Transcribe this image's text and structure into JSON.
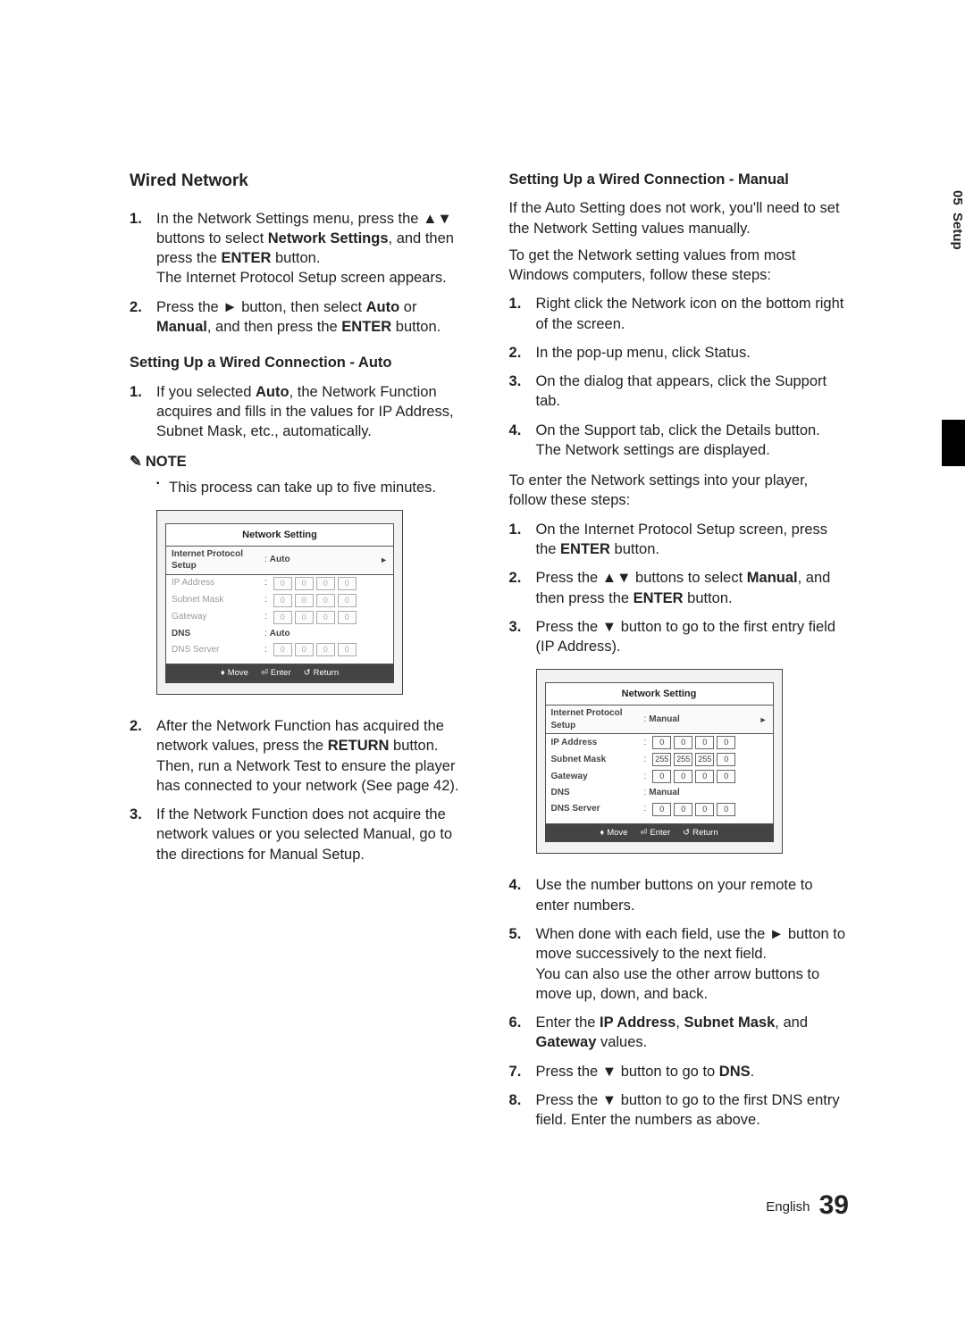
{
  "side": {
    "chapter": "05",
    "title": "Setup"
  },
  "pageFooter": {
    "lang": "English",
    "num": "39"
  },
  "left": {
    "heading": "Wired Network",
    "steps1": [
      {
        "parts": [
          "In the Network Settings menu, press the ▲▼ buttons to select ",
          {
            "b": "Network Settings"
          },
          ", and then press the ",
          {
            "b": "ENTER"
          },
          " button."
        ],
        "tail": "The Internet Protocol Setup screen appears."
      },
      {
        "parts": [
          "Press the ► button, then select ",
          {
            "b": "Auto"
          },
          " or ",
          {
            "b": "Manual"
          },
          ", and then press the ",
          {
            "b": "ENTER"
          },
          " button."
        ]
      }
    ],
    "subheading_auto": "Setting Up a Wired Connection - Auto",
    "steps2": [
      {
        "parts": [
          "If you selected ",
          {
            "b": "Auto"
          },
          ", the Network Function acquires and fills in the values for IP Address, Subnet Mask, etc., automatically."
        ]
      }
    ],
    "noteLabel": "NOTE",
    "noteItem": "This process can take up to five minutes.",
    "osd1": {
      "title": "Network Setting",
      "protocolLabel": "Internet Protocol Setup",
      "protocolValue": "Auto",
      "rows": [
        {
          "label": "IP Address",
          "cells": [
            "0",
            "0",
            "0",
            "0"
          ],
          "dim": true
        },
        {
          "label": "Subnet Mask",
          "cells": [
            "0",
            "0",
            "0",
            "0"
          ],
          "dim": true
        },
        {
          "label": "Gateway",
          "cells": [
            "0",
            "0",
            "0",
            "0"
          ],
          "dim": true
        }
      ],
      "dnsLabel": "DNS",
      "dnsValue": "Auto",
      "dnsServer": {
        "label": "DNS Server",
        "cells": [
          "0",
          "0",
          "0",
          "0"
        ],
        "dim": true
      },
      "footer": {
        "move": "Move",
        "enter": "Enter",
        "return": "Return"
      }
    },
    "steps3": [
      {
        "n": "2",
        "parts": [
          "After the Network Function has acquired the network values, press the ",
          {
            "b": "RETURN"
          },
          " button. Then, run a Network Test to ensure the player has connected to your network (See page 42)."
        ]
      },
      {
        "n": "3",
        "parts": [
          "If the Network Function does not acquire the network values or you selected Manual, go to the directions for Manual Setup."
        ]
      }
    ]
  },
  "right": {
    "subheading_manual": "Setting Up a Wired Connection - Manual",
    "intro1": "If the Auto Setting does not work, you'll need to set the Network Setting values manually.",
    "intro2": "To get the Network setting values from most Windows computers, follow these steps:",
    "stepsA": [
      {
        "parts": [
          "Right click the Network icon on the bottom right of the screen."
        ]
      },
      {
        "parts": [
          "In the pop-up menu, click Status."
        ]
      },
      {
        "parts": [
          "On the dialog that appears, click the Support tab."
        ]
      },
      {
        "parts": [
          "On the Support tab, click the Details button. The Network settings are displayed."
        ]
      }
    ],
    "intro3": "To enter the Network settings into your player, follow these steps:",
    "stepsB": [
      {
        "parts": [
          "On the Internet Protocol Setup screen, press the ",
          {
            "b": "ENTER"
          },
          " button."
        ]
      },
      {
        "parts": [
          "Press the ▲▼ buttons to select ",
          {
            "b": "Manual"
          },
          ", and then press the ",
          {
            "b": "ENTER"
          },
          " button."
        ]
      },
      {
        "parts": [
          "Press the ▼ button to go to the first entry field (IP Address)."
        ]
      }
    ],
    "osd2": {
      "title": "Network Setting",
      "protocolLabel": "Internet Protocol Setup",
      "protocolValue": "Manual",
      "rows": [
        {
          "label": "IP Address",
          "cells": [
            "0",
            "0",
            "0",
            "0"
          ]
        },
        {
          "label": "Subnet Mask",
          "cells": [
            "255",
            "255",
            "255",
            "0"
          ]
        },
        {
          "label": "Gateway",
          "cells": [
            "0",
            "0",
            "0",
            "0"
          ]
        }
      ],
      "dnsLabel": "DNS",
      "dnsValue": "Manual",
      "dnsServer": {
        "label": "DNS Server",
        "cells": [
          "0",
          "0",
          "0",
          "0"
        ]
      },
      "footer": {
        "move": "Move",
        "enter": "Enter",
        "return": "Return"
      }
    },
    "stepsC": [
      {
        "n": "4",
        "parts": [
          "Use the number buttons on your remote to enter numbers."
        ]
      },
      {
        "n": "5",
        "parts": [
          "When done with each field, use the ► button to move successively to the next field."
        ],
        "tail": "You can also use the other arrow buttons to move up, down, and back."
      },
      {
        "n": "6",
        "parts": [
          "Enter the ",
          {
            "b": "IP Address"
          },
          ", ",
          {
            "b": "Subnet Mask"
          },
          ", and ",
          {
            "b": "Gateway"
          },
          " values."
        ]
      },
      {
        "n": "7",
        "parts": [
          "Press the ▼ button to go to ",
          {
            "b": "DNS"
          },
          "."
        ]
      },
      {
        "n": "8",
        "parts": [
          "Press the ▼ button to go to the first DNS entry field. Enter the numbers as above."
        ]
      }
    ]
  }
}
